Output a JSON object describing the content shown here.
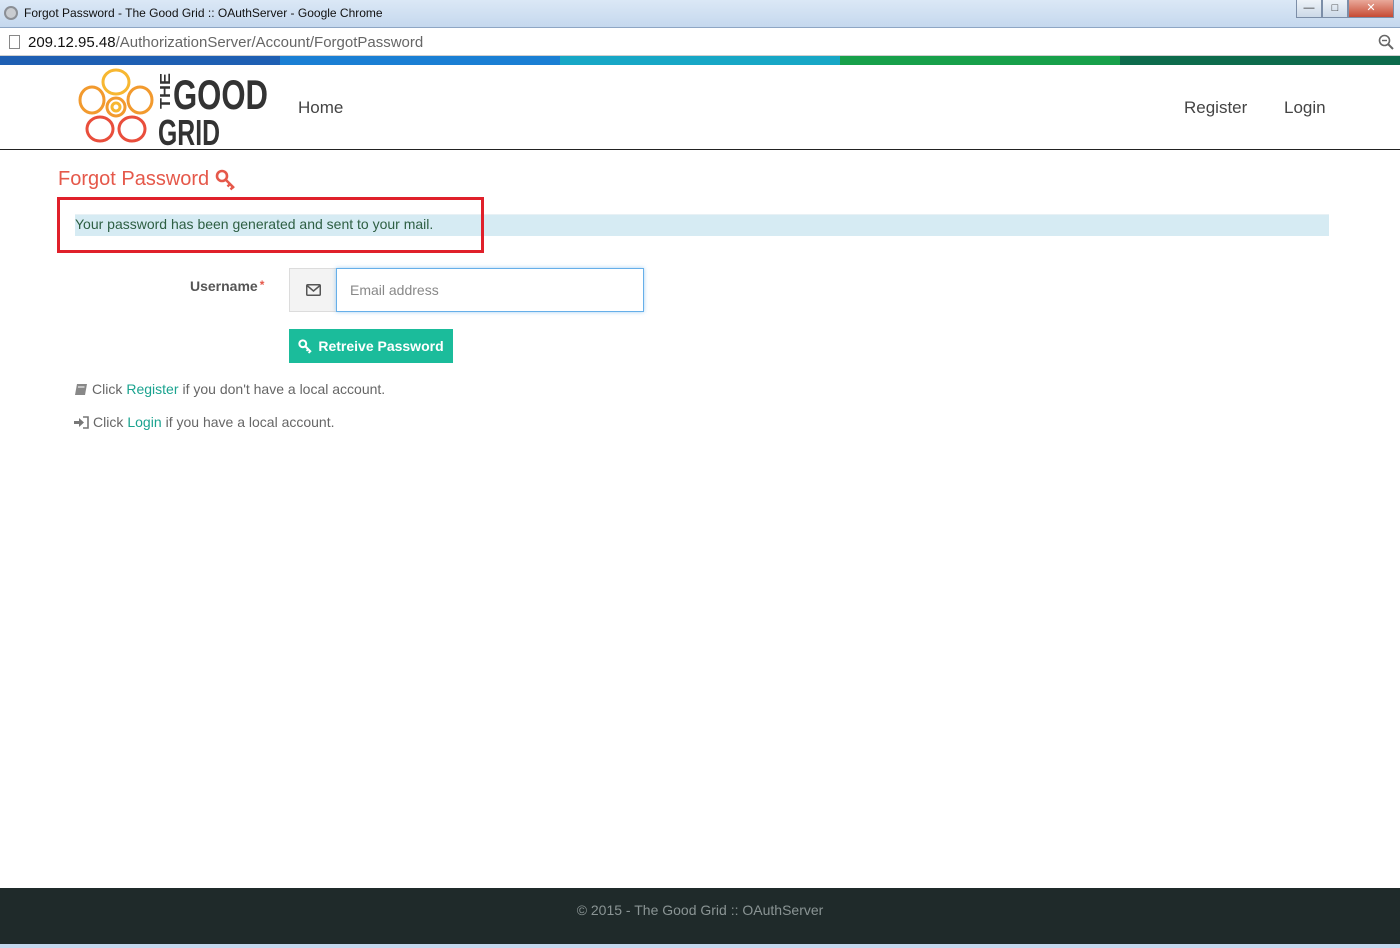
{
  "window": {
    "title": "Forgot Password - The Good Grid :: OAuthServer - Google Chrome",
    "buttons": {
      "minimize": "—",
      "maximize": "□",
      "close": "✕"
    }
  },
  "address_bar": {
    "host": "209.12.95.48",
    "path": "/AuthorizationServer/Account/ForgotPassword"
  },
  "color_strip": [
    "#1e5fb3",
    "#1a7fd4",
    "#17a7c6",
    "#17a04a",
    "#0d6b4c"
  ],
  "navbar": {
    "logo_text_top": "GOOD",
    "logo_text_side": "THE",
    "logo_text_bottom": "GRID",
    "home": "Home",
    "register": "Register",
    "login": "Login"
  },
  "page": {
    "title": "Forgot Password",
    "title_icon": "key-icon",
    "alert": "Your password has been generated and sent to your mail.",
    "form": {
      "username_label": "Username",
      "required_mark": "*",
      "email_placeholder": "Email address",
      "email_value": "",
      "retrieve_button": "Retreive Password"
    },
    "help": {
      "register_prefix": "Click",
      "register_link": "Register",
      "register_suffix": "if you don't have a local account.",
      "login_prefix": "Click",
      "login_link": "Login",
      "login_suffix": "if you have a local account."
    }
  },
  "footer": {
    "text": "© 2015 - The Good Grid :: OAuthServer"
  }
}
